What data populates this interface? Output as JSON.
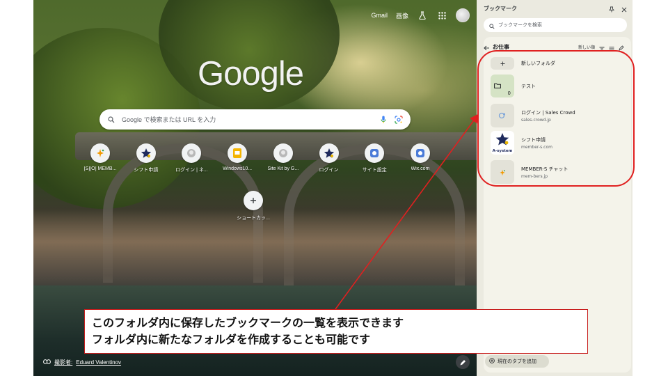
{
  "ntp": {
    "topbar": {
      "gmail": "Gmail",
      "images": "画像"
    },
    "logo": "Google",
    "search_placeholder": "Google で検索または URL を入力",
    "shortcuts": [
      {
        "label": "[S][O] MEMB..."
      },
      {
        "label": "シフト申請"
      },
      {
        "label": "ログイン | ネ..."
      },
      {
        "label": "Windows10..."
      },
      {
        "label": "Site Kit by G..."
      },
      {
        "label": "ログイン"
      },
      {
        "label": "サイト設定"
      },
      {
        "label": "Wix.com"
      }
    ],
    "add_shortcut_label": "ショートカッ...",
    "photo_credit_prefix": "撮影者:",
    "photo_credit_name": "Eduard Valentinov"
  },
  "sidepanel": {
    "title": "ブックマーク",
    "search_placeholder": "ブックマークを検索",
    "folder_name": "お仕事",
    "sort_label": "新しい順",
    "items": [
      {
        "title": "新しいフォルダ",
        "subtitle": ""
      },
      {
        "title": "テスト",
        "subtitle": "",
        "count": "0"
      },
      {
        "title": "ログイン | Sales Crowd",
        "subtitle": "sales-crowd.jp"
      },
      {
        "title": "シフト申請",
        "subtitle": "member-s.com"
      },
      {
        "title": "MEMBER-S チャット",
        "subtitle": "mem-bers.jp"
      }
    ],
    "add_tab_label": "現在のタブを追加",
    "shift_thumb_text": "A-system"
  },
  "annotation": {
    "line1": "このフォルダ内に保存したブックマークの一覧を表示できます",
    "line2": "フォルダ内に新たなフォルダを作成することも可能です",
    "color": "#e02020"
  }
}
